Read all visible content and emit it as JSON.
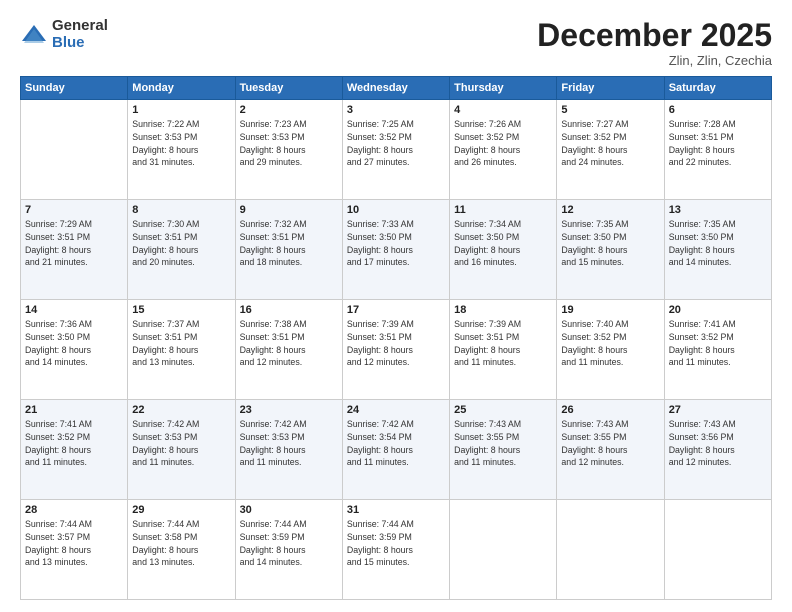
{
  "logo": {
    "general": "General",
    "blue": "Blue"
  },
  "header": {
    "month": "December 2025",
    "location": "Zlin, Zlin, Czechia"
  },
  "weekdays": [
    "Sunday",
    "Monday",
    "Tuesday",
    "Wednesday",
    "Thursday",
    "Friday",
    "Saturday"
  ],
  "weeks": [
    [
      {
        "day": "",
        "sunrise": "",
        "sunset": "",
        "daylight": ""
      },
      {
        "day": "1",
        "sunrise": "Sunrise: 7:22 AM",
        "sunset": "Sunset: 3:53 PM",
        "daylight": "Daylight: 8 hours and 31 minutes."
      },
      {
        "day": "2",
        "sunrise": "Sunrise: 7:23 AM",
        "sunset": "Sunset: 3:53 PM",
        "daylight": "Daylight: 8 hours and 29 minutes."
      },
      {
        "day": "3",
        "sunrise": "Sunrise: 7:25 AM",
        "sunset": "Sunset: 3:52 PM",
        "daylight": "Daylight: 8 hours and 27 minutes."
      },
      {
        "day": "4",
        "sunrise": "Sunrise: 7:26 AM",
        "sunset": "Sunset: 3:52 PM",
        "daylight": "Daylight: 8 hours and 26 minutes."
      },
      {
        "day": "5",
        "sunrise": "Sunrise: 7:27 AM",
        "sunset": "Sunset: 3:52 PM",
        "daylight": "Daylight: 8 hours and 24 minutes."
      },
      {
        "day": "6",
        "sunrise": "Sunrise: 7:28 AM",
        "sunset": "Sunset: 3:51 PM",
        "daylight": "Daylight: 8 hours and 22 minutes."
      }
    ],
    [
      {
        "day": "7",
        "sunrise": "Sunrise: 7:29 AM",
        "sunset": "Sunset: 3:51 PM",
        "daylight": "Daylight: 8 hours and 21 minutes."
      },
      {
        "day": "8",
        "sunrise": "Sunrise: 7:30 AM",
        "sunset": "Sunset: 3:51 PM",
        "daylight": "Daylight: 8 hours and 20 minutes."
      },
      {
        "day": "9",
        "sunrise": "Sunrise: 7:32 AM",
        "sunset": "Sunset: 3:51 PM",
        "daylight": "Daylight: 8 hours and 18 minutes."
      },
      {
        "day": "10",
        "sunrise": "Sunrise: 7:33 AM",
        "sunset": "Sunset: 3:50 PM",
        "daylight": "Daylight: 8 hours and 17 minutes."
      },
      {
        "day": "11",
        "sunrise": "Sunrise: 7:34 AM",
        "sunset": "Sunset: 3:50 PM",
        "daylight": "Daylight: 8 hours and 16 minutes."
      },
      {
        "day": "12",
        "sunrise": "Sunrise: 7:35 AM",
        "sunset": "Sunset: 3:50 PM",
        "daylight": "Daylight: 8 hours and 15 minutes."
      },
      {
        "day": "13",
        "sunrise": "Sunrise: 7:35 AM",
        "sunset": "Sunset: 3:50 PM",
        "daylight": "Daylight: 8 hours and 14 minutes."
      }
    ],
    [
      {
        "day": "14",
        "sunrise": "Sunrise: 7:36 AM",
        "sunset": "Sunset: 3:50 PM",
        "daylight": "Daylight: 8 hours and 14 minutes."
      },
      {
        "day": "15",
        "sunrise": "Sunrise: 7:37 AM",
        "sunset": "Sunset: 3:51 PM",
        "daylight": "Daylight: 8 hours and 13 minutes."
      },
      {
        "day": "16",
        "sunrise": "Sunrise: 7:38 AM",
        "sunset": "Sunset: 3:51 PM",
        "daylight": "Daylight: 8 hours and 12 minutes."
      },
      {
        "day": "17",
        "sunrise": "Sunrise: 7:39 AM",
        "sunset": "Sunset: 3:51 PM",
        "daylight": "Daylight: 8 hours and 12 minutes."
      },
      {
        "day": "18",
        "sunrise": "Sunrise: 7:39 AM",
        "sunset": "Sunset: 3:51 PM",
        "daylight": "Daylight: 8 hours and 11 minutes."
      },
      {
        "day": "19",
        "sunrise": "Sunrise: 7:40 AM",
        "sunset": "Sunset: 3:52 PM",
        "daylight": "Daylight: 8 hours and 11 minutes."
      },
      {
        "day": "20",
        "sunrise": "Sunrise: 7:41 AM",
        "sunset": "Sunset: 3:52 PM",
        "daylight": "Daylight: 8 hours and 11 minutes."
      }
    ],
    [
      {
        "day": "21",
        "sunrise": "Sunrise: 7:41 AM",
        "sunset": "Sunset: 3:52 PM",
        "daylight": "Daylight: 8 hours and 11 minutes."
      },
      {
        "day": "22",
        "sunrise": "Sunrise: 7:42 AM",
        "sunset": "Sunset: 3:53 PM",
        "daylight": "Daylight: 8 hours and 11 minutes."
      },
      {
        "day": "23",
        "sunrise": "Sunrise: 7:42 AM",
        "sunset": "Sunset: 3:53 PM",
        "daylight": "Daylight: 8 hours and 11 minutes."
      },
      {
        "day": "24",
        "sunrise": "Sunrise: 7:42 AM",
        "sunset": "Sunset: 3:54 PM",
        "daylight": "Daylight: 8 hours and 11 minutes."
      },
      {
        "day": "25",
        "sunrise": "Sunrise: 7:43 AM",
        "sunset": "Sunset: 3:55 PM",
        "daylight": "Daylight: 8 hours and 11 minutes."
      },
      {
        "day": "26",
        "sunrise": "Sunrise: 7:43 AM",
        "sunset": "Sunset: 3:55 PM",
        "daylight": "Daylight: 8 hours and 12 minutes."
      },
      {
        "day": "27",
        "sunrise": "Sunrise: 7:43 AM",
        "sunset": "Sunset: 3:56 PM",
        "daylight": "Daylight: 8 hours and 12 minutes."
      }
    ],
    [
      {
        "day": "28",
        "sunrise": "Sunrise: 7:44 AM",
        "sunset": "Sunset: 3:57 PM",
        "daylight": "Daylight: 8 hours and 13 minutes."
      },
      {
        "day": "29",
        "sunrise": "Sunrise: 7:44 AM",
        "sunset": "Sunset: 3:58 PM",
        "daylight": "Daylight: 8 hours and 13 minutes."
      },
      {
        "day": "30",
        "sunrise": "Sunrise: 7:44 AM",
        "sunset": "Sunset: 3:59 PM",
        "daylight": "Daylight: 8 hours and 14 minutes."
      },
      {
        "day": "31",
        "sunrise": "Sunrise: 7:44 AM",
        "sunset": "Sunset: 3:59 PM",
        "daylight": "Daylight: 8 hours and 15 minutes."
      },
      {
        "day": "",
        "sunrise": "",
        "sunset": "",
        "daylight": ""
      },
      {
        "day": "",
        "sunrise": "",
        "sunset": "",
        "daylight": ""
      },
      {
        "day": "",
        "sunrise": "",
        "sunset": "",
        "daylight": ""
      }
    ]
  ]
}
